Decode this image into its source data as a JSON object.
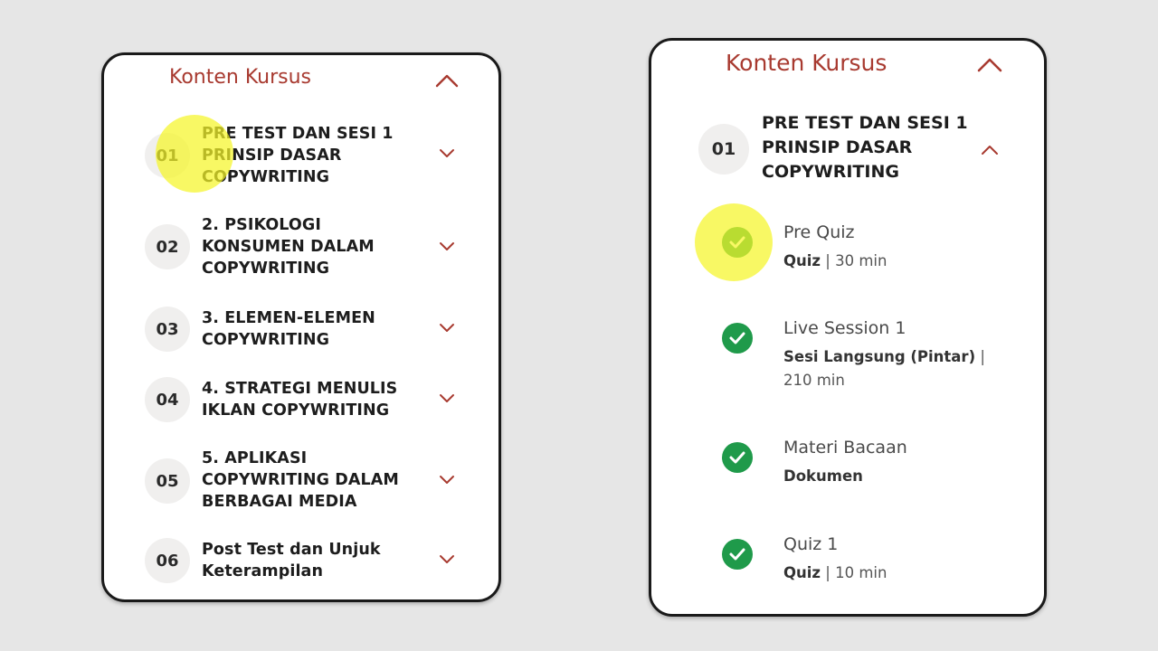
{
  "colors": {
    "accent": "#a83a30",
    "check_green": "#1f9a4a",
    "highlight_yellow": "#f5f528",
    "circle_bg": "#f0efee"
  },
  "left_panel": {
    "title": "Konten Kursus",
    "expanded": true,
    "sections": [
      {
        "number": "01",
        "title": "PRE TEST DAN SESI 1 PRINSIP DASAR COPYWRITING",
        "icon": "chevron-down-icon"
      },
      {
        "number": "02",
        "title": "2. PSIKOLOGI KONSUMEN DALAM COPYWRITING",
        "icon": "chevron-down-icon"
      },
      {
        "number": "03",
        "title": "3. ELEMEN-ELEMEN COPYWRITING",
        "icon": "chevron-down-icon"
      },
      {
        "number": "04",
        "title": "4. STRATEGI MENULIS IKLAN COPYWRITING",
        "icon": "chevron-down-icon"
      },
      {
        "number": "05",
        "title": "5. APLIKASI COPYWRITING DALAM BERBAGAI MEDIA",
        "icon": "chevron-down-icon"
      },
      {
        "number": "06",
        "title": "Post Test dan Unjuk Keterampilan",
        "icon": "chevron-down-icon"
      }
    ]
  },
  "right_panel": {
    "title": "Konten Kursus",
    "section": {
      "number": "01",
      "title": "PRE TEST DAN SESI 1 PRINSIP DASAR COPYWRITING",
      "expanded": true
    },
    "lessons": [
      {
        "title": "Pre Quiz",
        "type": "Quiz",
        "separator": " | ",
        "duration": "30 min",
        "completed": true,
        "icon": "check-circle-icon"
      },
      {
        "title": "Live Session 1",
        "type": "Sesi Langsung (Pintar)",
        "separator": " | ",
        "duration": "210 min",
        "completed": true,
        "icon": "check-circle-icon"
      },
      {
        "title": "Materi Bacaan",
        "type": "Dokumen",
        "separator": "",
        "duration": "",
        "completed": true,
        "icon": "check-circle-icon"
      },
      {
        "title": "Quiz 1",
        "type": "Quiz",
        "separator": " | ",
        "duration": "10 min",
        "completed": true,
        "icon": "check-circle-icon"
      }
    ]
  }
}
